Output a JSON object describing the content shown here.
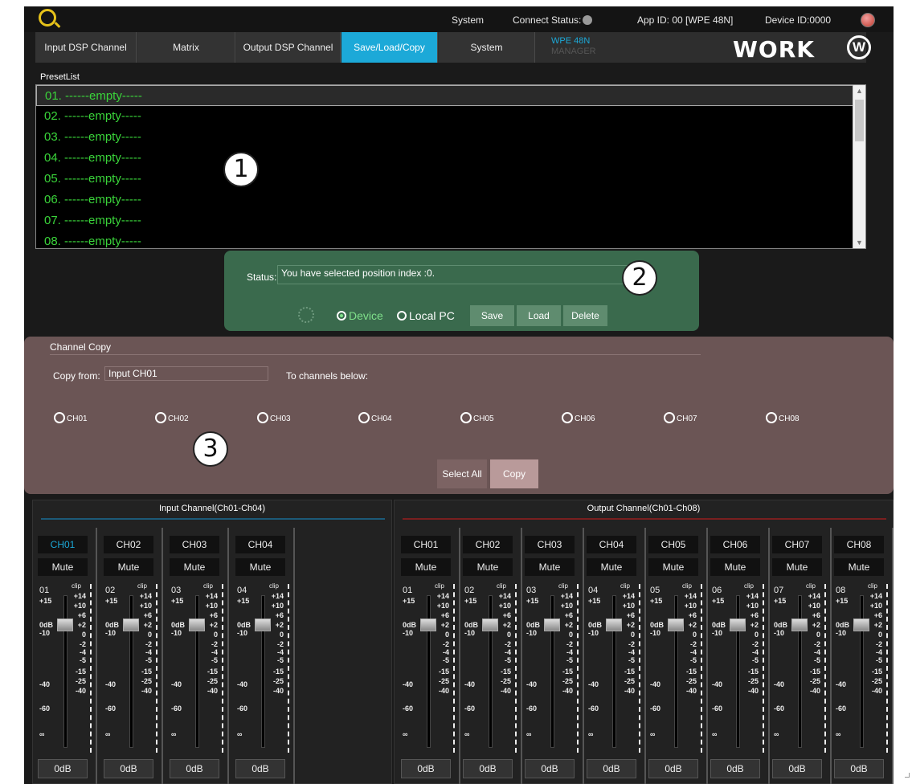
{
  "topbar": {
    "system": "System",
    "connect_status": "Connect  Status:",
    "app_id": "App ID:  00  [WPE 48N]",
    "device_id": "Device ID:0000"
  },
  "tabs": [
    {
      "label": "Input DSP Channel",
      "active": false
    },
    {
      "label": "Matrix",
      "active": false
    },
    {
      "label": "Output DSP Channel",
      "active": false
    },
    {
      "label": "Save/Load/Copy",
      "active": true
    },
    {
      "label": "System",
      "active": false
    }
  ],
  "product": {
    "line1": "WPE 48N",
    "line2": "MANAGER"
  },
  "brand": {
    "name": "WORK",
    "mark": "W"
  },
  "presetlist": {
    "label": "PresetList",
    "items": [
      "01. ------empty-----",
      "02. ------empty-----",
      "03. ------empty-----",
      "04. ------empty-----",
      "05. ------empty-----",
      "06. ------empty-----",
      "07. ------empty-----",
      "08. ------empty-----"
    ]
  },
  "markers": [
    "1",
    "2",
    "3"
  ],
  "status": {
    "label": "Status:",
    "value": "You have selected position index :0.",
    "radio_device": "Device",
    "radio_local": "Local PC",
    "save": "Save",
    "load": "Load",
    "delete": "Delete"
  },
  "copy": {
    "title": "Channel Copy",
    "from_label": "Copy from:",
    "from_value": "Input CH01",
    "to_label": "To channels below:",
    "channels": [
      "CH01",
      "CH02",
      "CH03",
      "CH04",
      "CH05",
      "CH06",
      "CH07",
      "CH08"
    ],
    "select_all": "Select All",
    "copy": "Copy"
  },
  "input_panel": {
    "title": "Input Channel(Ch01-Ch04)",
    "strips": [
      {
        "name": "CH01",
        "num": "01",
        "active": true
      },
      {
        "name": "CH02",
        "num": "02",
        "active": false
      },
      {
        "name": "CH03",
        "num": "03",
        "active": false
      },
      {
        "name": "CH04",
        "num": "04",
        "active": false
      }
    ]
  },
  "output_panel": {
    "title": "Output Channel(Ch01-Ch08)",
    "strips": [
      {
        "name": "CH01",
        "num": "01",
        "active": false
      },
      {
        "name": "CH02",
        "num": "02",
        "active": false
      },
      {
        "name": "CH03",
        "num": "03",
        "active": false
      },
      {
        "name": "CH04",
        "num": "04",
        "active": false
      },
      {
        "name": "CH05",
        "num": "05",
        "active": false
      },
      {
        "name": "CH06",
        "num": "06",
        "active": false
      },
      {
        "name": "CH07",
        "num": "07",
        "active": false
      },
      {
        "name": "CH08",
        "num": "08",
        "active": false
      }
    ]
  },
  "strip_common": {
    "mute": "Mute",
    "clip": "clip",
    "gain": "0dB",
    "left_scale": [
      "+15",
      "0dB",
      "-10",
      "-40",
      "-60",
      "∞"
    ],
    "right_scale": [
      "+14",
      "+10",
      "+6",
      "+2",
      "0",
      "-2",
      "-4",
      "-5",
      "-15",
      "-25",
      "-40"
    ]
  }
}
